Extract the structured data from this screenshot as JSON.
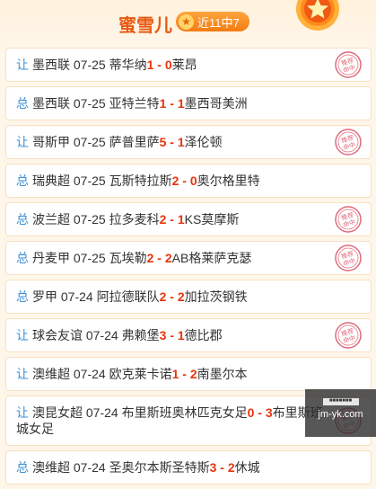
{
  "header": {
    "title": "蜜雪儿",
    "badge_text": "近11中7",
    "badge_icon": "star-icon",
    "medal_icon": "medal-star-icon"
  },
  "colors": {
    "accent": "#e85a13",
    "score": "#e8340c",
    "tag": "#3d8fd8",
    "stamp": "#e06a7a"
  },
  "rows": [
    {
      "tag": "让",
      "league": "墨西联",
      "date": "07-25",
      "home": "蒂华纳",
      "hs": "1",
      "sep": " - ",
      "as": "0",
      "away": "莱昂",
      "stamp": "推荐命中"
    },
    {
      "tag": "总",
      "league": "墨西联",
      "date": "07-25",
      "home": "亚特兰特",
      "hs": "1",
      "sep": " - ",
      "as": "1",
      "away": "墨西哥美洲",
      "stamp": ""
    },
    {
      "tag": "让",
      "league": "哥斯甲",
      "date": "07-25",
      "home": "萨普里萨",
      "hs": "5",
      "sep": " - ",
      "as": "1",
      "away": "泽伦顿",
      "stamp": "推荐命中"
    },
    {
      "tag": "总",
      "league": "瑞典超",
      "date": "07-25",
      "home": "瓦斯特拉斯",
      "hs": "2",
      "sep": " - ",
      "as": "0",
      "away": "奥尔格里特",
      "stamp": ""
    },
    {
      "tag": "总",
      "league": "波兰超",
      "date": "07-25",
      "home": "拉多麦科",
      "hs": "2",
      "sep": " - ",
      "as": "1",
      "away": "KS莫摩斯",
      "stamp": "推荐命中"
    },
    {
      "tag": "总",
      "league": "丹麦甲",
      "date": "07-25",
      "home": "瓦埃勒",
      "hs": "2",
      "sep": " - ",
      "as": "2",
      "away": "AB格莱萨克瑟",
      "stamp": "推荐命中"
    },
    {
      "tag": "总",
      "league": "罗甲",
      "date": "07-24",
      "home": "阿拉德联队",
      "hs": "2",
      "sep": " - ",
      "as": "2",
      "away": "加拉茨钢铁",
      "stamp": ""
    },
    {
      "tag": "让",
      "league": "球会友谊",
      "date": "07-24",
      "home": "弗赖堡",
      "hs": "3",
      "sep": " - ",
      "as": "1",
      "away": "德比郡",
      "stamp": "推荐命中"
    },
    {
      "tag": "让",
      "league": "澳维超",
      "date": "07-24",
      "home": "欧克莱卡诺",
      "hs": "1",
      "sep": " - ",
      "as": "2",
      "away": "南墨尔本",
      "stamp": ""
    },
    {
      "tag": "让",
      "league": "澳昆女超",
      "date": "07-24",
      "home": "布里斯班奥林匹克女足",
      "hs": "0",
      "sep": " - ",
      "as": "3",
      "away": "布里斯班城女足",
      "stamp": "推荐命中"
    },
    {
      "tag": "总",
      "league": "澳维超",
      "date": "07-24",
      "home": "圣奥尔本斯圣特斯",
      "hs": "3",
      "sep": " - ",
      "as": "2",
      "away": "休城",
      "stamp": ""
    }
  ],
  "watermark": {
    "top": "■■■■■■■",
    "site": "jm-yk.com"
  }
}
